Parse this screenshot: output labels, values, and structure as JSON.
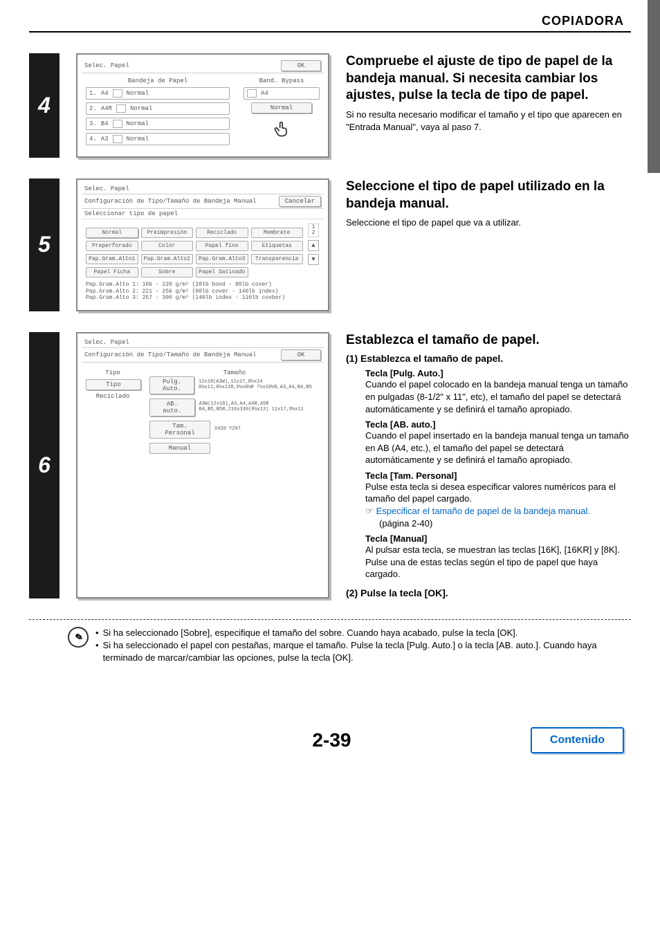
{
  "header": {
    "title": "COPIADORA"
  },
  "step4": {
    "num": "4",
    "screen": {
      "title": "Selec. Papel",
      "ok": "OK",
      "col1_header": "Bandeja de Papel",
      "col2_header": "Band. Bypass",
      "trays": [
        {
          "id": "1.",
          "size": "A4",
          "type": "Normal"
        },
        {
          "id": "2.",
          "size": "A4R",
          "type": "Normal"
        },
        {
          "id": "3.",
          "size": "B4",
          "type": "Normal"
        },
        {
          "id": "4.",
          "size": "A3",
          "type": "Normal"
        }
      ],
      "bypass": {
        "size": "A4",
        "type": "Normal"
      }
    },
    "lead": "Compruebe el ajuste de tipo de papel de la bandeja manual. Si necesita cambiar los ajustes, pulse la tecla de tipo de papel.",
    "sub": "Si no resulta necesario modificar el tamaño y el tipo que aparecen en \"Entrada Manual\", vaya al paso 7."
  },
  "step5": {
    "num": "5",
    "screen": {
      "title": "Selec. Papel",
      "subtitle": "Configuración de Tipo/Tamaño de Bandeja Manual",
      "cancel": "Cancelar",
      "select_label": "Seleccionar tipo de papel",
      "page_ind_top": "1",
      "page_ind_bot": "2",
      "buttons": [
        "Normal",
        "Preimpresión",
        "Reciclado",
        "Membrete",
        "Preperforado",
        "Color",
        "Papel fino",
        "Etiquetas",
        "Pap.Gram.Alto1",
        "Pap.Gram.Alto2",
        "Pap.Gram.Alto3",
        "Transparencia",
        "Papel Ficha",
        "Sobre",
        "Papel Satinado"
      ],
      "notes": [
        "Pap.Gram.Alto 1: 106 - 220 g/m² (28lb bond - 80lb cover)",
        "Pap.Gram.Alto 2: 221 - 256 g/m² (80lb cover - 140lb index)",
        "Pap.Gram.Alto 3: 257 - 300 g/m² (140lb index - 110lb covber)"
      ]
    },
    "lead": "Seleccione el tipo de papel utilizado en la bandeja manual.",
    "sub": "Seleccione el tipo de papel que va a utilizar."
  },
  "step6": {
    "num": "6",
    "screen": {
      "title": "Selec. Papel",
      "subtitle": "Configuración de Tipo/Tamaño de Bandeja Manual",
      "ok": "OK",
      "tipo_header": "Tipo",
      "tamano_header": "Tamaño",
      "tipo_btn": "Tipo",
      "tipo_val": "Reciclado",
      "rows": [
        {
          "btn": "Pulg. Auto.",
          "desc": "12x18(A3W),11x17,8½x14\n8½x11,8½x11R,5½x8½R\n7¼x10½R,A3,A4,B4,B5"
        },
        {
          "btn": "AB. auto.",
          "desc": "A3W(12x18),A3,A4,A4R,A5R\nB4,B5,B5R,216x330(8½x13)\n11x17,8½x11"
        },
        {
          "btn": "Tam. Personal",
          "desc": "X420 Y297"
        },
        {
          "btn": "Manual",
          "desc": ""
        }
      ]
    },
    "lead": "Establezca el tamaño de papel.",
    "item1_head": "(1)  Establezca el tamaño de papel.",
    "k1": "Tecla [Pulg. Auto.]",
    "k1_body": "Cuando el papel colocado en la bandeja manual tenga un tamaño en pulgadas (8-1/2\" x 11\", etc), el tamaño del papel se detectará automáticamente y se definirá el tamaño apropiado.",
    "k2": "Tecla [AB. auto.]",
    "k2_body": "Cuando el papel insertado en la bandeja manual tenga un tamaño en AB (A4, etc.), el tamaño del papel se detectará automáticamente y se definirá el tamaño apropiado.",
    "k3": "Tecla [Tam. Personal]",
    "k3_body": "Pulse esta tecla si desea especificar valores numéricos para el tamaño del papel cargado.",
    "k3_link": "Especificar el tamaño de papel de la bandeja manual.",
    "k3_link_page": "(página 2-40)",
    "k4": "Tecla [Manual]",
    "k4_body": "Al pulsar esta tecla, se muestran las teclas [16K], [16KR] y [8K]. Pulse una de estas teclas según el tipo de papel que haya cargado.",
    "item2_head": "(2)  Pulse la tecla [OK]."
  },
  "notes": {
    "bullet": "•",
    "n1": "Si ha seleccionado [Sobre], especifique el tamaño del sobre. Cuando haya acabado, pulse la tecla [OK].",
    "n2": "Si ha seleccionado el papel con pestañas, marque el tamaño. Pulse la tecla [Pulg. Auto.] o la tecla [AB. auto.]. Cuando haya terminado de marcar/cambiar las opciones, pulse la tecla [OK]."
  },
  "footer": {
    "page": "2-39",
    "link": "Contenido"
  }
}
